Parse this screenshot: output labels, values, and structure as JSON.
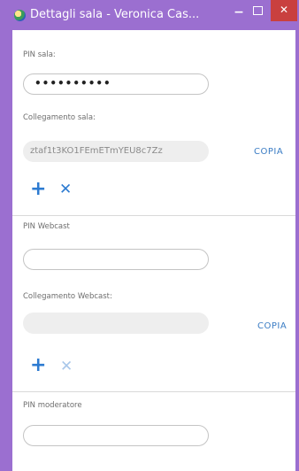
{
  "window": {
    "title": "Dettagli sala - Veronica Cas...",
    "minimize_symbol": "−",
    "close_symbol": "✕"
  },
  "room": {
    "pin_label": "PIN sala:",
    "pin_value": "••••••••••",
    "link_label": "Collegamento sala:",
    "link_value": "ztaf1t3KO1FEmETmYEU8c7Zz",
    "copy_label": "COPIA"
  },
  "webcast": {
    "pin_label": "PIN Webcast",
    "pin_value": "",
    "link_label": "Collegamento Webcast:",
    "link_value": "",
    "copy_label": "COPIA"
  },
  "moderator": {
    "pin_label": "PIN moderatore",
    "pin_value": ""
  },
  "icons": {
    "add": "+",
    "remove": "✕"
  },
  "colors": {
    "frame": "#9b6fd0",
    "accent": "#2d7bd1",
    "close_button": "#c9403f"
  }
}
